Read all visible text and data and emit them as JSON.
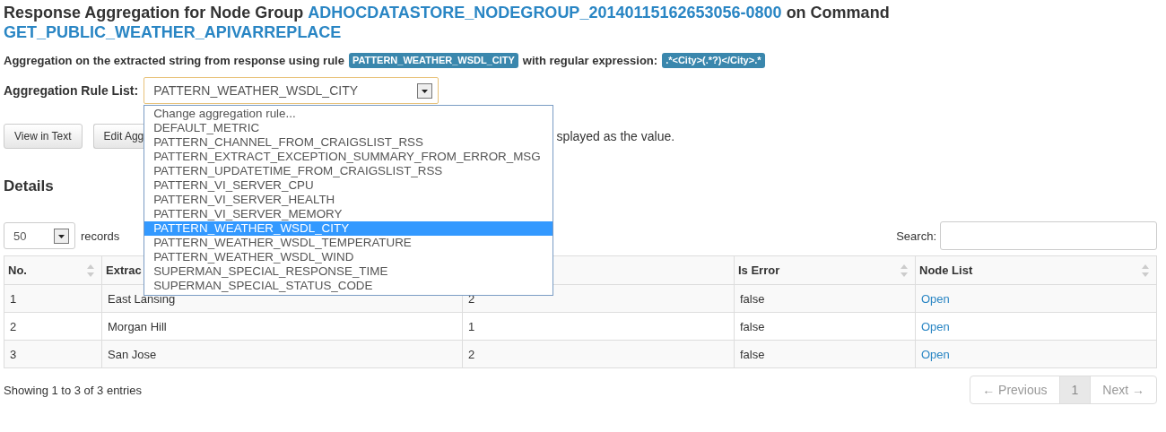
{
  "heading": {
    "prefix": "Response Aggregation for Node Group",
    "node_group": "ADHOCDATASTORE_NODEGROUP_20140115162653056-0800",
    "middle": "on Command",
    "command": "GET_PUBLIC_WEATHER_APIVARREPLACE"
  },
  "rule_line": {
    "text": "Aggregation on the extracted string from response using rule",
    "rule": "PATTERN_WEATHER_WSDL_CITY",
    "text2": "with regular expression:",
    "regex": ".*<City>(.*?)</City>.*"
  },
  "rule_list": {
    "label": "Aggregation Rule List:",
    "value": "PATTERN_WEATHER_WSDL_CITY",
    "open": true,
    "options": [
      {
        "label": "Change aggregation rule...",
        "selected": false
      },
      {
        "label": "DEFAULT_METRIC",
        "selected": false
      },
      {
        "label": "PATTERN_CHANNEL_FROM_CRAIGSLIST_RSS",
        "selected": false
      },
      {
        "label": "PATTERN_EXTRACT_EXCEPTION_SUMMARY_FROM_ERROR_MSG",
        "selected": false
      },
      {
        "label": "PATTERN_UPDATETIME_FROM_CRAIGSLIST_RSS",
        "selected": false
      },
      {
        "label": "PATTERN_VI_SERVER_CPU",
        "selected": false
      },
      {
        "label": "PATTERN_VI_SERVER_HEALTH",
        "selected": false
      },
      {
        "label": "PATTERN_VI_SERVER_MEMORY",
        "selected": false
      },
      {
        "label": "PATTERN_WEATHER_WSDL_CITY",
        "selected": true
      },
      {
        "label": "PATTERN_WEATHER_WSDL_TEMPERATURE",
        "selected": false
      },
      {
        "label": "PATTERN_WEATHER_WSDL_WIND",
        "selected": false
      },
      {
        "label": "SUPERMAN_SPECIAL_RESPONSE_TIME",
        "selected": false
      },
      {
        "label": "SUPERMAN_SPECIAL_STATUS_CODE",
        "selected": false
      }
    ]
  },
  "buttons": [
    "View in Text",
    "Edit Agg"
  ],
  "hint": "splayed as the value.",
  "details_title": "Details",
  "length": {
    "value": "50",
    "label": "records"
  },
  "search": {
    "label": "Search:"
  },
  "table": {
    "columns": [
      "No.",
      "Extrac",
      "",
      "Is Error",
      "Node List"
    ],
    "rows": [
      [
        "1",
        "East Lansing",
        "2",
        "false",
        "Open"
      ],
      [
        "2",
        "Morgan Hill",
        "1",
        "false",
        "Open"
      ],
      [
        "3",
        "San Jose",
        "2",
        "false",
        "Open"
      ]
    ]
  },
  "info": "Showing 1 to 3 of 3 entries",
  "pagination": [
    {
      "label": "← Previous",
      "disabled": true,
      "selected": false
    },
    {
      "label": "1",
      "disabled": false,
      "selected": true
    },
    {
      "label": "Next →",
      "disabled": true,
      "selected": false
    }
  ]
}
